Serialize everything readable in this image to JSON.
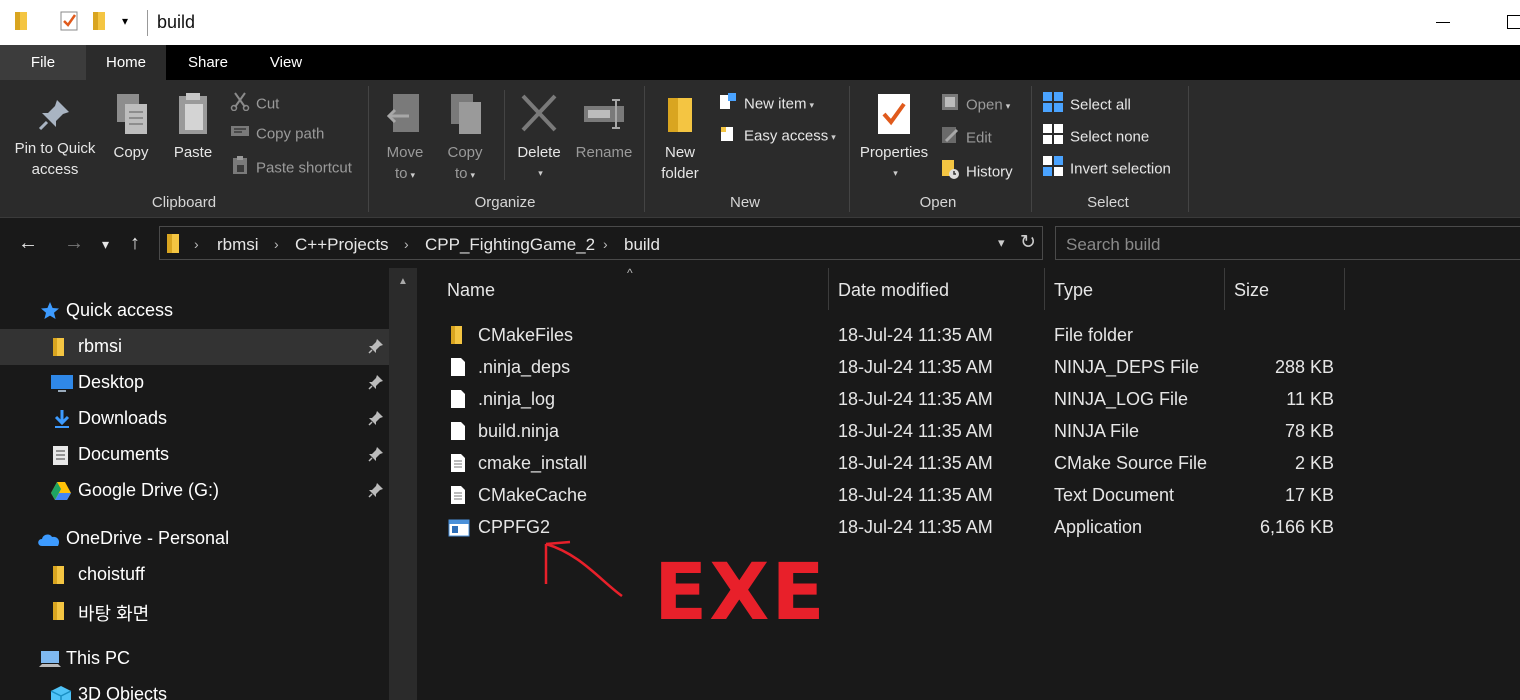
{
  "window": {
    "title": "build"
  },
  "tabs": [
    "File",
    "Home",
    "Share",
    "View"
  ],
  "ribbon": {
    "clipboard": {
      "label": "Clipboard",
      "pin": "Pin to Quick access",
      "pin_line1": "Pin to Quick",
      "pin_line2": "access",
      "copy": "Copy",
      "paste": "Paste",
      "cut": "Cut",
      "copy_path": "Copy path",
      "paste_shortcut": "Paste shortcut"
    },
    "organize": {
      "label": "Organize",
      "move_line1": "Move",
      "move_line2": "to",
      "copy_line1": "Copy",
      "copy_line2": "to",
      "delete": "Delete",
      "rename": "Rename"
    },
    "new": {
      "label": "New",
      "folder_line1": "New",
      "folder_line2": "folder",
      "new_item": "New item",
      "easy_access": "Easy access"
    },
    "open": {
      "label": "Open",
      "properties": "Properties",
      "open": "Open",
      "edit": "Edit",
      "history": "History"
    },
    "select": {
      "label": "Select",
      "select_all": "Select all",
      "select_none": "Select none",
      "invert": "Invert selection"
    }
  },
  "address": {
    "crumbs": [
      "rbmsi",
      "C++Projects",
      "CPP_FightingGame_2",
      "build"
    ],
    "search_placeholder": "Search build"
  },
  "nav": {
    "quick_access": "Quick access",
    "items": [
      {
        "label": "rbmsi",
        "icon": "folder-icon",
        "pinned": true
      },
      {
        "label": "Desktop",
        "icon": "desktop-icon",
        "pinned": true
      },
      {
        "label": "Downloads",
        "icon": "download-icon",
        "pinned": true
      },
      {
        "label": "Documents",
        "icon": "documents-icon",
        "pinned": true
      },
      {
        "label": "Google Drive (G:)",
        "icon": "google-drive-icon",
        "pinned": true
      }
    ],
    "onedrive": "OneDrive - Personal",
    "onedrive_items": [
      "choistuff",
      "바탕 화면"
    ],
    "this_pc": "This PC",
    "objects3d": "3D Objects"
  },
  "columns": {
    "name": "Name",
    "date": "Date modified",
    "type": "Type",
    "size": "Size"
  },
  "files": [
    {
      "name": "CMakeFiles",
      "date": "18-Jul-24 11:35 AM",
      "type": "File folder",
      "size": "",
      "icon": "folder-icon"
    },
    {
      "name": ".ninja_deps",
      "date": "18-Jul-24 11:35 AM",
      "type": "NINJA_DEPS File",
      "size": "288 KB",
      "icon": "file-icon"
    },
    {
      "name": ".ninja_log",
      "date": "18-Jul-24 11:35 AM",
      "type": "NINJA_LOG File",
      "size": "11 KB",
      "icon": "file-icon"
    },
    {
      "name": "build.ninja",
      "date": "18-Jul-24 11:35 AM",
      "type": "NINJA File",
      "size": "78 KB",
      "icon": "file-icon"
    },
    {
      "name": "cmake_install",
      "date": "18-Jul-24 11:35 AM",
      "type": "CMake Source File",
      "size": "2 KB",
      "icon": "text-file-icon"
    },
    {
      "name": "CMakeCache",
      "date": "18-Jul-24 11:35 AM",
      "type": "Text Document",
      "size": "17 KB",
      "icon": "text-file-icon"
    },
    {
      "name": "CPPFG2",
      "date": "18-Jul-24 11:35 AM",
      "type": "Application",
      "size": "6,166 KB",
      "icon": "application-icon"
    }
  ],
  "annotation": {
    "text": "EXE",
    "color": "#e8202a"
  }
}
